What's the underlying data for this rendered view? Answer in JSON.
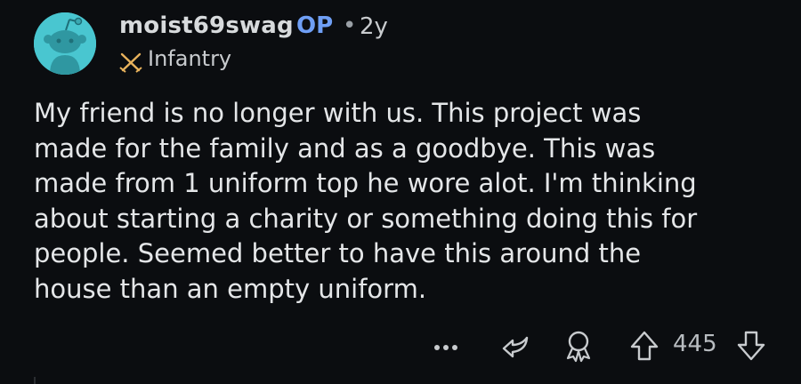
{
  "comment": {
    "username": "moist69swag",
    "op_label": "OP",
    "separator": "•",
    "age": "2y",
    "flair": {
      "icon": "crossed-swords-icon",
      "text": "Infantry",
      "color": "#e8b25c"
    },
    "avatar": {
      "icon": "snoo-avatar-icon",
      "background": "#49c6d0"
    },
    "body": "My friend is no longer with us. This project was\nmade for the family and as a goodbye. This was\nmade from 1 uniform top he wore alot. I'm thinking\nabout starting a charity or something doing this for\npeople. Seemed better to have this around the\nhouse than an empty uniform.",
    "actions": {
      "more_icon": "more-options-icon",
      "reply_icon": "reply-icon",
      "award_icon": "award-icon",
      "upvote_icon": "upvote-icon",
      "score": "445",
      "downvote_icon": "downvote-icon"
    }
  },
  "colors": {
    "background": "#0b0d10",
    "text": "#e4e6e8",
    "op": "#6f9ff5",
    "muted": "#b8bcc0"
  }
}
